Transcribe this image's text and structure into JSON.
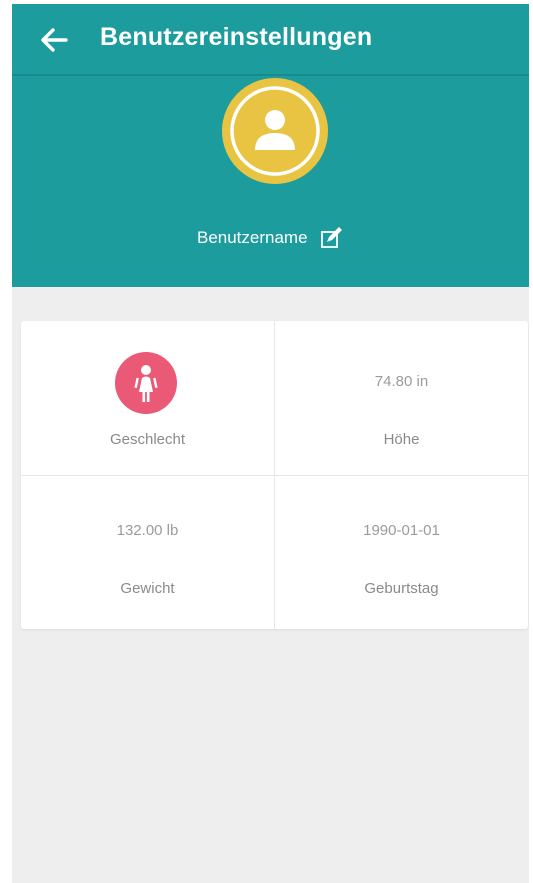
{
  "header": {
    "title": "Benutzereinstellungen",
    "back_icon": "arrow-left-icon",
    "username": "Benutzername",
    "edit_icon": "edit-icon",
    "avatar_icon": "user-avatar-icon",
    "colors": {
      "primary": "#1d9c9e",
      "avatar": "#e9c342",
      "background": "#eeeeee"
    }
  },
  "profile": {
    "gender": {
      "label": "Geschlecht",
      "icon": "female-icon",
      "icon_color": "#ea5a77"
    },
    "height": {
      "value": "74.80 in",
      "label": "Höhe"
    },
    "weight": {
      "value": "132.00 lb",
      "label": "Gewicht"
    },
    "birthday": {
      "value": "1990-01-01",
      "label": "Geburtstag"
    }
  }
}
